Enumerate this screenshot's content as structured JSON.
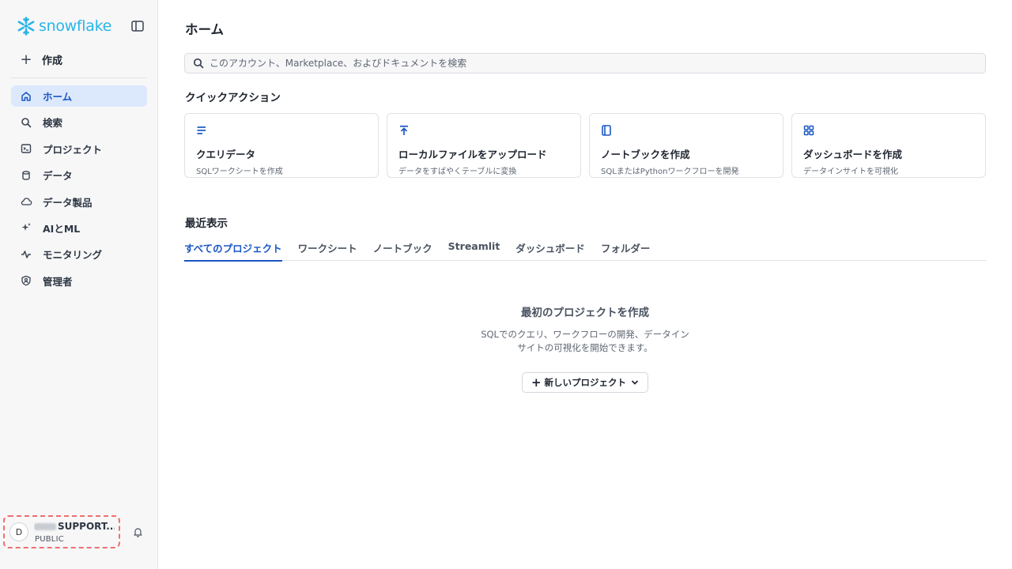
{
  "brand": {
    "name": "snowflake",
    "color": "#29b5e8"
  },
  "sidebar": {
    "create_label": "作成",
    "items": [
      {
        "label": "ホーム",
        "icon": "home-icon",
        "active": true
      },
      {
        "label": "検索",
        "icon": "search-icon"
      },
      {
        "label": "プロジェクト",
        "icon": "terminal-icon"
      },
      {
        "label": "データ",
        "icon": "database-icon"
      },
      {
        "label": "データ製品",
        "icon": "cloud-icon"
      },
      {
        "label": "AIとML",
        "icon": "sparkle-icon"
      },
      {
        "label": "モニタリング",
        "icon": "activity-icon"
      },
      {
        "label": "管理者",
        "icon": "shield-user-icon"
      }
    ],
    "user": {
      "initial": "D",
      "name": "SUPPORT...",
      "role": "PUBLIC"
    }
  },
  "main": {
    "title": "ホーム",
    "search": {
      "placeholder": "このアカウント、Marketplace、およびドキュメントを検索"
    },
    "quick_actions_title": "クイックアクション",
    "quick_actions": [
      {
        "title": "クエリデータ",
        "subtitle": "SQLワークシートを作成",
        "icon": "lines-icon"
      },
      {
        "title": "ローカルファイルをアップロード",
        "subtitle": "データをすばやくテーブルに変換",
        "icon": "upload-icon"
      },
      {
        "title": "ノートブックを作成",
        "subtitle": "SQLまたはPythonワークフローを開発",
        "icon": "notebook-icon"
      },
      {
        "title": "ダッシュボードを作成",
        "subtitle": "データインサイトを可視化",
        "icon": "dashboard-grid-icon"
      }
    ],
    "recent_title": "最近表示",
    "tabs": [
      "すべてのプロジェクト",
      "ワークシート",
      "ノートブック",
      "Streamlit",
      "ダッシュボード",
      "フォルダー"
    ],
    "active_tab": 0,
    "empty": {
      "title": "最初のプロジェクトを作成",
      "description": "SQLでのクエリ、ワークフローの開発、データインサイトの可視化を開始できます。",
      "button_label": "新しいプロジェクト"
    }
  },
  "colors": {
    "accent": "#1a56c4",
    "active_bg": "#dce8fb",
    "highlight_border": "#ee7070"
  }
}
